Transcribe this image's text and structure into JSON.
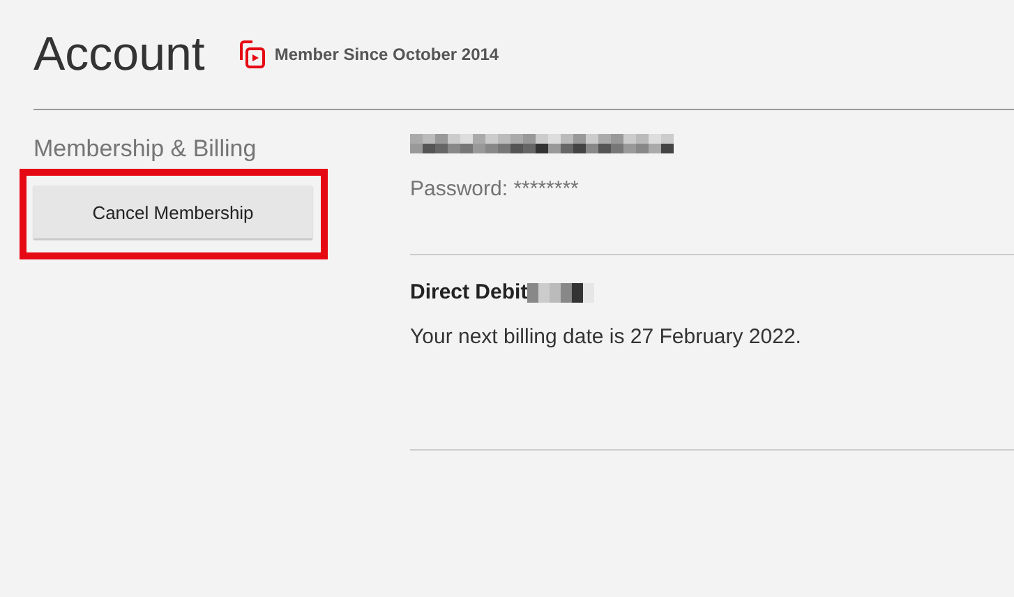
{
  "header": {
    "title": "Account",
    "member_since": "Member Since October 2014"
  },
  "section": {
    "title": "Membership & Billing",
    "cancel_button": "Cancel Membership"
  },
  "details": {
    "password": "Password: ********",
    "payment_method": "Direct Debit",
    "billing_note": "Your next billing date is 27 February 2022."
  }
}
